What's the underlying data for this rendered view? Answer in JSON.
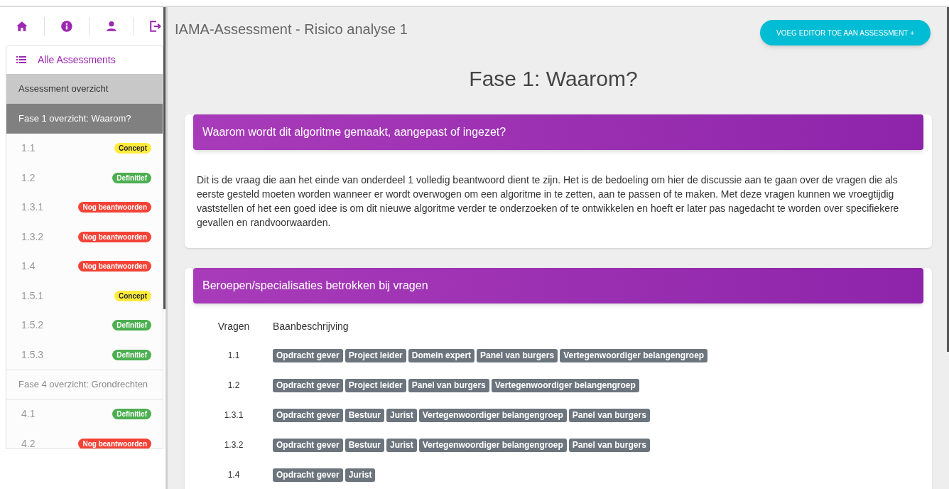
{
  "sidebar": {
    "header": "Alle Assessments",
    "items": [
      {
        "kind": "overview",
        "label": "Assessment overzicht",
        "selected": false
      },
      {
        "kind": "phase",
        "label": "Fase 1 overzicht: Waarom?",
        "selected": true
      },
      {
        "kind": "question",
        "label": "1.1",
        "status": "Concept",
        "color": "#ffeb3b"
      },
      {
        "kind": "question",
        "label": "1.2",
        "status": "Definitief",
        "color": "#4caf50"
      },
      {
        "kind": "question",
        "label": "1.3.1",
        "status": "Nog beantwoorden",
        "color": "#f44336"
      },
      {
        "kind": "question",
        "label": "1.3.2",
        "status": "Nog beantwoorden",
        "color": "#f44336"
      },
      {
        "kind": "question",
        "label": "1.4",
        "status": "Nog beantwoorden",
        "color": "#f44336"
      },
      {
        "kind": "question",
        "label": "1.5.1",
        "status": "Concept",
        "color": "#ffeb3b"
      },
      {
        "kind": "question",
        "label": "1.5.2",
        "status": "Definitief",
        "color": "#4caf50"
      },
      {
        "kind": "question",
        "label": "1.5.3",
        "status": "Definitief",
        "color": "#4caf50"
      },
      {
        "kind": "phase",
        "label": "Fase 4 overzicht: Grondrechten",
        "selected": false
      },
      {
        "kind": "question",
        "label": "4.1",
        "status": "Definitief",
        "color": "#4caf50"
      },
      {
        "kind": "question",
        "label": "4.2",
        "status": "Nog beantwoorden",
        "color": "#f44336"
      }
    ]
  },
  "page_title": "IAMA-Assessment - Risico analyse 1",
  "add_editor_button": "VOEG EDITOR TOE AAN ASSESSMENT +",
  "phase_title": "Fase 1: Waarom?",
  "question_card": {
    "title": "Waarom wordt dit algoritme gemaakt, aangepast of ingezet?",
    "text": "Dit is de vraag die aan het einde van onderdeel 1 volledig beantwoord dient te zijn. Het is de bedoeling om hier de discussie aan te gaan over de vragen die als eerste gesteld moeten worden wanneer er wordt overwogen om een algoritme in te zetten, aan te passen of te maken. Met deze vragen kunnen we vroegtijdig vaststellen of het een goed idee is om dit nieuwe algoritme verder te onderzoeken of te ontwikkelen en hoeft er later pas nagedacht te worden over specifiekere gevallen en randvoorwaarden."
  },
  "roles_card": {
    "title": "Beroepen/specialisaties betrokken bij vragen",
    "columns": [
      "Vragen",
      "Baanbeschrijving"
    ],
    "rows": [
      {
        "question": "1.1",
        "roles": [
          "Opdracht gever",
          "Project leider",
          "Domein expert",
          "Panel van burgers",
          "Vertegenwoordiger belangengroep"
        ]
      },
      {
        "question": "1.2",
        "roles": [
          "Opdracht gever",
          "Project leider",
          "Panel van burgers",
          "Vertegenwoordiger belangengroep"
        ]
      },
      {
        "question": "1.3.1",
        "roles": [
          "Opdracht gever",
          "Bestuur",
          "Jurist",
          "Vertegenwoordiger belangengroep",
          "Panel van burgers"
        ]
      },
      {
        "question": "1.3.2",
        "roles": [
          "Opdracht gever",
          "Bestuur",
          "Jurist",
          "Vertegenwoordiger belangengroep",
          "Panel van burgers"
        ]
      },
      {
        "question": "1.4",
        "roles": [
          "Opdracht gever",
          "Jurist"
        ]
      }
    ]
  }
}
